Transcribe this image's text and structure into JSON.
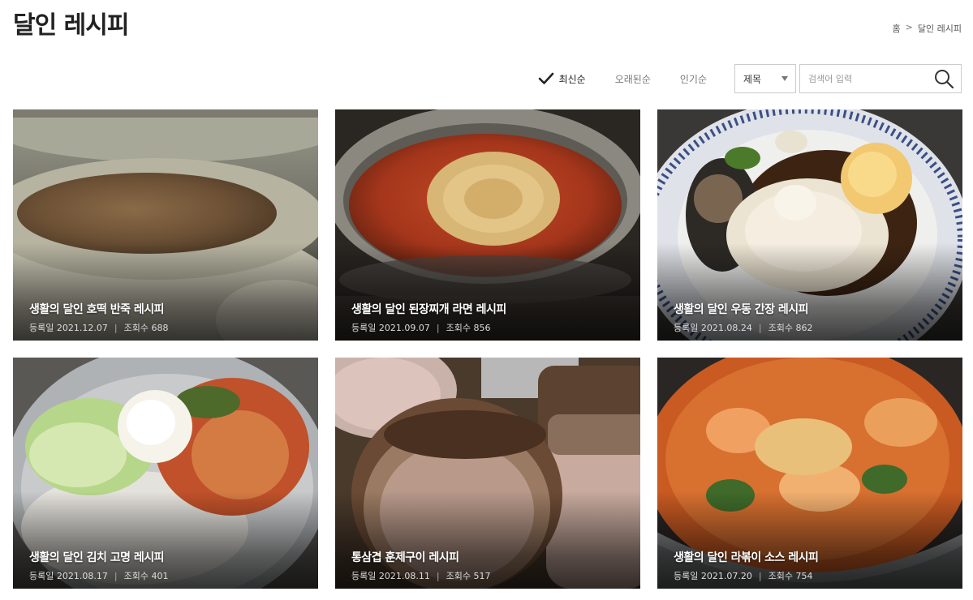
{
  "page": {
    "title": "달인 레시피"
  },
  "breadcrumb": {
    "home": "홈",
    "separator": ">",
    "current": "달인 레시피"
  },
  "sort": {
    "options": [
      "최신순",
      "오래된순",
      "인기순"
    ],
    "active": "최신순"
  },
  "search": {
    "field_select": "제목",
    "placeholder": "검색어 입력",
    "value": ""
  },
  "colors": {
    "accent": "#222222",
    "muted": "#777777",
    "border": "#cccccc"
  },
  "meta_labels": {
    "date": "등록일",
    "views": "조회수",
    "divider": "|"
  },
  "cards": [
    {
      "title": "생활의 달인 호떡 반죽 레시피",
      "date": "2021.12.07",
      "views": "688",
      "image": "hotteok-dough-photo"
    },
    {
      "title": "생활의 달인 된장찌개 라면 레시피",
      "date": "2021.09.07",
      "views": "856",
      "image": "doenjang-ramen-photo"
    },
    {
      "title": "생활의 달인 우동 간장 레시피",
      "date": "2021.08.24",
      "views": "862",
      "image": "udon-soy-photo"
    },
    {
      "title": "생활의 달인 김치 고명 레시피",
      "date": "2021.08.17",
      "views": "401",
      "image": "kimchi-garnish-noodle-photo"
    },
    {
      "title": "통삼겹 훈제구이 레시피",
      "date": "2021.08.11",
      "views": "517",
      "image": "smoked-pork-belly-photo"
    },
    {
      "title": "생활의 달인 라볶이 소스 레시피",
      "date": "2021.07.20",
      "views": "754",
      "image": "rabokki-photo"
    }
  ]
}
